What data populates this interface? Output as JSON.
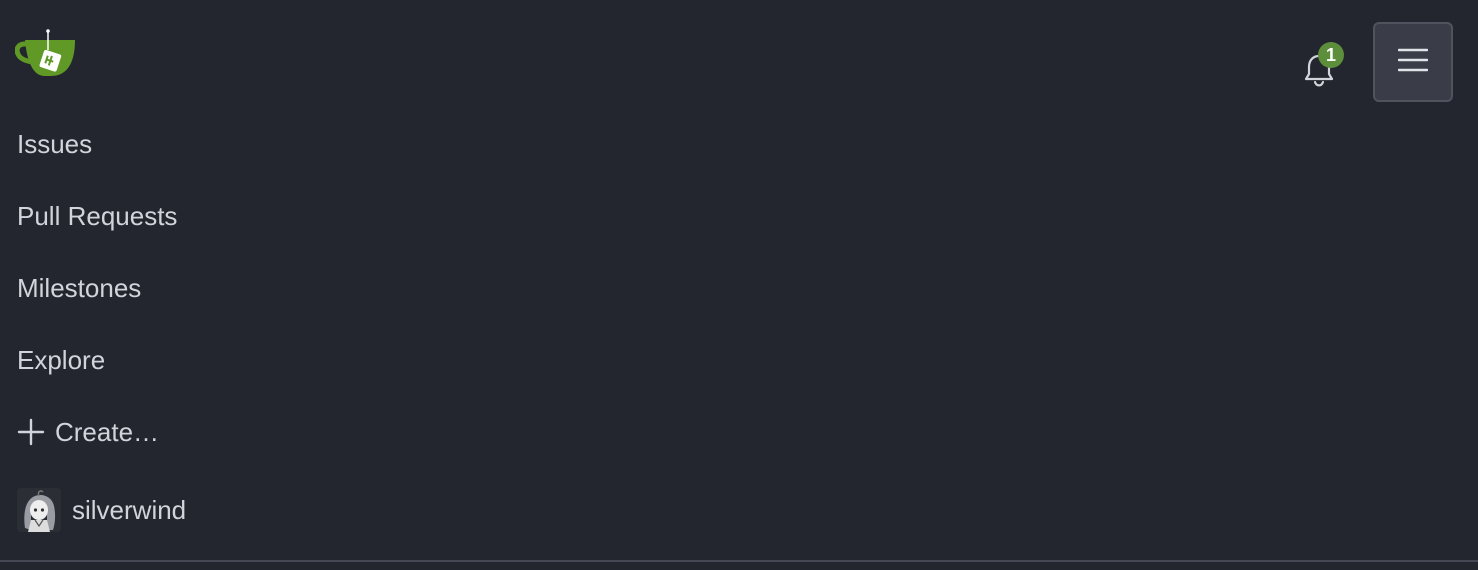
{
  "navbar": {
    "logo_icon": "gitea-logo",
    "notifications": {
      "icon": "bell-icon",
      "count": "1",
      "badge_color": "#5c8e3b"
    },
    "menu_toggle_icon": "hamburger-menu-icon",
    "items": [
      {
        "label": "Issues"
      },
      {
        "label": "Pull Requests"
      },
      {
        "label": "Milestones"
      },
      {
        "label": "Explore"
      },
      {
        "label": "Create…",
        "icon": "plus-icon"
      }
    ],
    "user": {
      "name": "silverwind",
      "avatar_icon": "user-avatar"
    }
  },
  "colors": {
    "background": "#24262f",
    "text": "#d2d4db",
    "brand_green": "#609926"
  }
}
